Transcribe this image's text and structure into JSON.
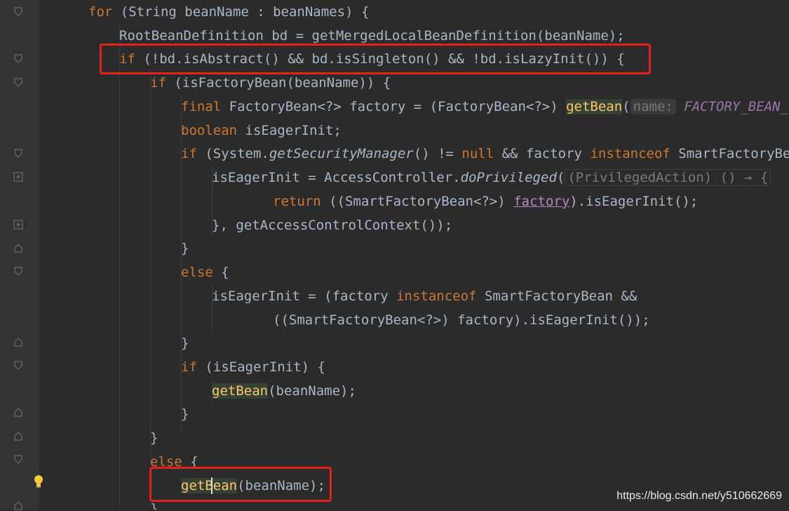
{
  "gutter": {
    "bulb_icon": "lightbulb-icon"
  },
  "code": {
    "line1": {
      "kw": "for",
      "a": " (String beanName : beanNames) ",
      "b": "{"
    },
    "line2": {
      "a": "RootBeanDefinition bd = getMergedLocalBeanDefinition(beanName);"
    },
    "line3": {
      "kw": "if",
      "a": " (!bd.isAbstract() && bd.isSingleton() && !bd.isLazyInit()) ",
      "b": "{"
    },
    "line4": {
      "kw": "if",
      "a": " (isFactoryBean(beanName)) ",
      "b": "{"
    },
    "line5": {
      "kw": "final",
      "a": " FactoryBean<?> factory = (FactoryBean<?>) ",
      "m": "getBean",
      "b": "(",
      "hint": "name:",
      "c": " FACTORY_BEAN_PRE"
    },
    "line6": {
      "kw": "boolean",
      "a": " isEagerInit;"
    },
    "line7": {
      "kw": "if",
      "a": " (System.",
      "it": "getSecurityManager",
      "b": "() != ",
      "kw2": "null",
      "c": " && factory ",
      "kw3": "instanceof",
      "d": " SmartFactoryBean)"
    },
    "line8": {
      "a": "isEagerInit = AccessController.",
      "it": "doPrivileged",
      "b": "(",
      "hint": "(PrivilegedAction) () → {"
    },
    "line9": {
      "kw": "return",
      "a": " ((SmartFactoryBean<?>) ",
      "und": "factory",
      "b": ").isEagerInit();"
    },
    "line10": {
      "a": "}, getAccessControlContext());"
    },
    "line11": {
      "a": "}"
    },
    "line12": {
      "kw": "else",
      "a": " {"
    },
    "line13": {
      "a": "isEagerInit = (factory ",
      "kw": "instanceof",
      "b": " SmartFactoryBean &&"
    },
    "line14": {
      "a": "((SmartFactoryBean<?>) factory).isEagerInit());"
    },
    "line15": {
      "a": "}"
    },
    "line16": {
      "kw": "if",
      "a": " (isEagerInit) {"
    },
    "line17": {
      "m": "getBean",
      "a": "(beanName);"
    },
    "line18": {
      "a": "}"
    },
    "line19": {
      "a": "}"
    },
    "line20": {
      "kw": "else",
      "a": " {"
    },
    "line21": {
      "m": "getBean",
      "a": "(beanName);"
    },
    "line22": {
      "a": "}"
    }
  },
  "watermark": "https://blog.csdn.net/y510662669"
}
